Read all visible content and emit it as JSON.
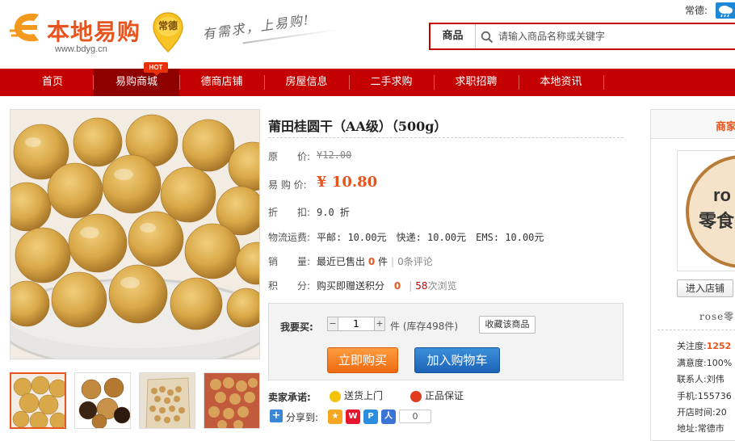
{
  "header": {
    "logo_text": "本地易购",
    "logo_url": "www.bdyg.cn",
    "city_badge": "常德",
    "slogan": "有需求，上易购!",
    "top_city": "常德:",
    "search": {
      "category": "商品",
      "placeholder": "请输入商品名称或关键字"
    }
  },
  "nav": {
    "hot_badge": "HOT",
    "items": [
      {
        "label": "首页"
      },
      {
        "label": "易购商城"
      },
      {
        "label": "德商店铺"
      },
      {
        "label": "房屋信息"
      },
      {
        "label": "二手求购"
      },
      {
        "label": "求职招聘"
      },
      {
        "label": "本地资讯"
      }
    ]
  },
  "product": {
    "title": "莆田桂圆干（AA级）（500g）",
    "original_price_label": "原　　价:",
    "original_price": "¥12.00",
    "sale_price_label": "易 购 价:",
    "sale_price": "¥ 10.80",
    "discount_label": "折　　扣:",
    "discount": "9.0 折",
    "shipping_label": "物流运费:",
    "shipping": "平邮: 10.00元　快递: 10.00元　EMS: 10.00元",
    "sales_label": "销　　量:",
    "sales_prefix": "最近已售出",
    "sales_count": "0",
    "sales_unit": "件",
    "reviews": "0条评论",
    "points_label": "积　　分:",
    "points_prefix": "购买即赠送积分",
    "points_value": "0",
    "views_count": "58",
    "views_suffix": "次浏览"
  },
  "purchase": {
    "qty_label": "我要买:",
    "qty_minus": "−",
    "qty_value": "1",
    "qty_plus": "+",
    "stock_text": "件  (库存498件)",
    "favorite": "收藏该商品",
    "buy_now": "立即购买",
    "add_to_cart": "加入购物车"
  },
  "promise": {
    "label": "卖家承诺:",
    "items": [
      "送货上门",
      "正品保证"
    ]
  },
  "share": {
    "label": "分享到:",
    "count": "0"
  },
  "store": {
    "title": "商家",
    "logo_text_top": "ro",
    "logo_text_bottom": "零食",
    "enter": "进入店铺",
    "name": "rose零",
    "attention_label": "关注度:",
    "attention_value": "1252",
    "satisfaction_label": "满意度:",
    "satisfaction_value": "100%",
    "contact_label": "联系人:",
    "contact_value": "刘伟",
    "phone_label": "手机:",
    "phone_value": "155736",
    "open_label": "开店时间:",
    "open_value": "20",
    "address_label": "地址:",
    "address_value": "常德市"
  },
  "colors": {
    "brand_red": "#c40000",
    "accent_orange": "#e8541d",
    "buy_button": "#ee6a10",
    "cart_button": "#1c63b8"
  }
}
